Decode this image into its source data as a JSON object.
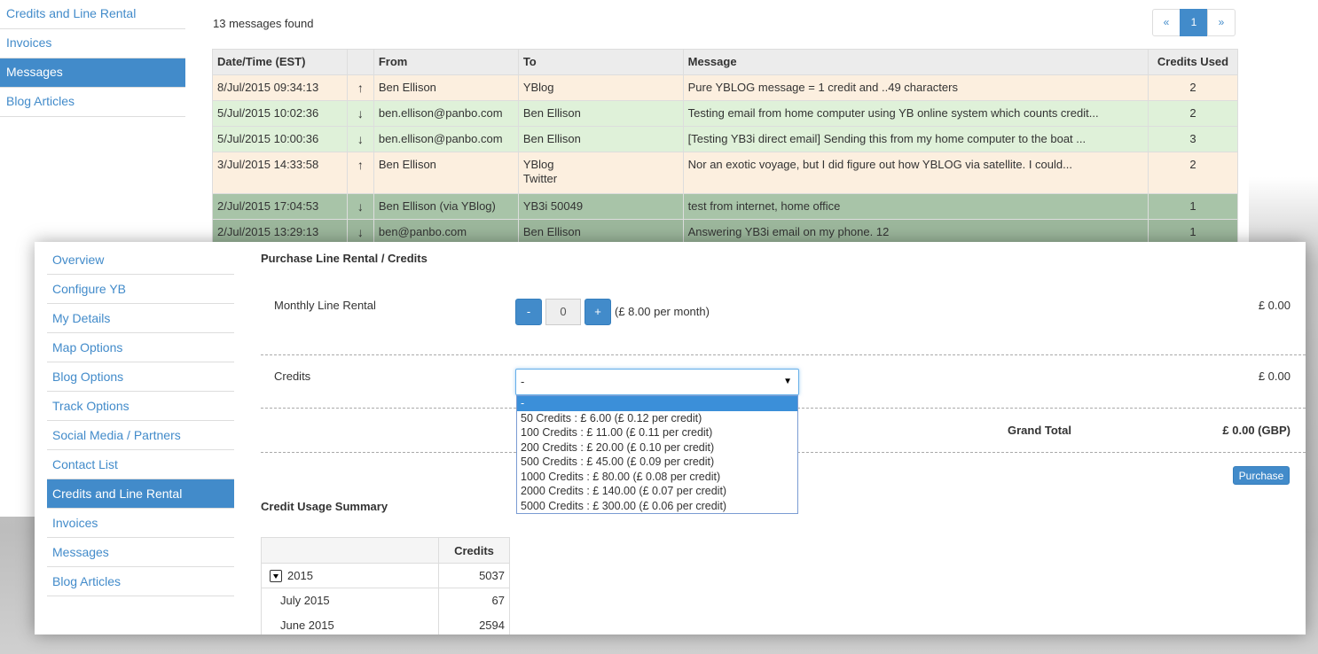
{
  "background_window": {
    "sidebar": [
      {
        "label": "Credits and Line Rental",
        "active": false
      },
      {
        "label": "Invoices",
        "active": false
      },
      {
        "label": "Messages",
        "active": true
      },
      {
        "label": "Blog Articles",
        "active": false
      }
    ],
    "messages_count": "13 messages found",
    "pagination": {
      "prev": "«",
      "current": "1",
      "next": "»"
    },
    "table": {
      "headers": [
        "Date/Time (EST)",
        "",
        "From",
        "To",
        "Message",
        "Credits Used"
      ],
      "rows": [
        {
          "datetime": "8/Jul/2015 09:34:13",
          "direction": "↑",
          "direction_icon": "arrow-up-icon",
          "from": "Ben Ellison",
          "to": "YBlog",
          "to2": "",
          "message": "Pure YBLOG message = 1 credit and ..49 characters",
          "credits": "2",
          "style": "out"
        },
        {
          "datetime": "5/Jul/2015 10:02:36",
          "direction": "↓",
          "direction_icon": "arrow-down-icon",
          "from": "ben.ellison@panbo.com",
          "to": "Ben Ellison",
          "to2": "",
          "message": "Testing email from home computer using YB online system which counts credit...",
          "credits": "2",
          "style": "in"
        },
        {
          "datetime": "5/Jul/2015 10:00:36",
          "direction": "↓",
          "direction_icon": "arrow-down-icon",
          "from": "ben.ellison@panbo.com",
          "to": "Ben Ellison",
          "to2": "",
          "message": "[Testing YB3i direct email] Sending this from my home computer to the boat ...",
          "credits": "3",
          "style": "in"
        },
        {
          "datetime": "3/Jul/2015 14:33:58",
          "direction": "↑",
          "direction_icon": "arrow-up-icon",
          "from": "Ben Ellison",
          "to": "YBlog",
          "to2": "Twitter",
          "message": "Nor an exotic voyage, but I did figure out how YBLOG via satellite. I could...",
          "credits": "2",
          "style": "out"
        },
        {
          "datetime": "2/Jul/2015 17:04:53",
          "direction": "↓",
          "direction_icon": "arrow-down-icon",
          "from": "Ben Ellison (via YBlog)",
          "to": "YB3i 50049",
          "to2": "",
          "message": "test from internet, home office",
          "credits": "1",
          "style": "dark"
        },
        {
          "datetime": "2/Jul/2015 13:29:13",
          "direction": "↓",
          "direction_icon": "arrow-down-icon",
          "from": "ben@panbo.com",
          "to": "Ben Ellison",
          "to2": "",
          "message": "Answering YB3i email on my phone. 12",
          "credits": "1",
          "style": "dark2"
        }
      ]
    }
  },
  "front_window": {
    "sidebar": [
      {
        "label": "Overview",
        "active": false
      },
      {
        "label": "Configure YB",
        "active": false
      },
      {
        "label": "My Details",
        "active": false
      },
      {
        "label": "Map Options",
        "active": false
      },
      {
        "label": "Blog Options",
        "active": false
      },
      {
        "label": "Track Options",
        "active": false
      },
      {
        "label": "Social Media / Partners",
        "active": false
      },
      {
        "label": "Contact List",
        "active": false
      },
      {
        "label": "Credits and Line Rental",
        "active": true
      },
      {
        "label": "Invoices",
        "active": false
      },
      {
        "label": "Messages",
        "active": false
      },
      {
        "label": "Blog Articles",
        "active": false
      }
    ],
    "purchase_heading": "Purchase Line Rental / Credits",
    "rental": {
      "label": "Monthly Line Rental",
      "minus": "-",
      "quantity": "0",
      "plus": "+",
      "rate": "(£ 8.00 per month)",
      "price": "£ 0.00"
    },
    "credits": {
      "label": "Credits",
      "selected": "-",
      "price": "£ 0.00",
      "options": [
        "-",
        "50 Credits : £ 6.00 (£ 0.12 per credit)",
        "100 Credits : £ 11.00 (£ 0.11 per credit)",
        "200 Credits : £ 20.00 (£ 0.10 per credit)",
        "500 Credits : £ 45.00 (£ 0.09 per credit)",
        "1000 Credits : £ 80.00 (£ 0.08 per credit)",
        "2000 Credits : £ 140.00 (£ 0.07 per credit)",
        "5000 Credits : £ 300.00 (£ 0.06 per credit)"
      ]
    },
    "grand_total": {
      "label": "Grand Total",
      "value": "£ 0.00 (GBP)"
    },
    "purchase_button": "Purchase",
    "usage_heading": "Credit Usage Summary",
    "usage_table": {
      "header": "Credits",
      "year": {
        "label": "2015",
        "value": "5037"
      },
      "months": [
        {
          "label": "July 2015",
          "value": "67"
        },
        {
          "label": "June 2015",
          "value": "2594"
        }
      ]
    }
  }
}
